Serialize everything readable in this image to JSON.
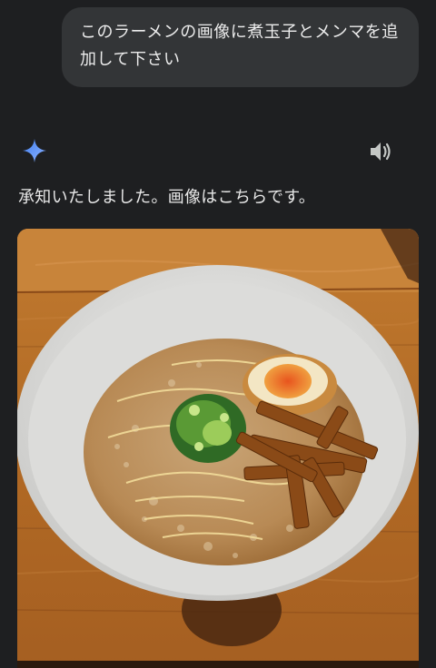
{
  "conversation": {
    "user_message": "このラーメンの画像に煮玉子とメンマを追加して下さい",
    "assistant_reply": "承知いたしました。画像はこちらです。"
  },
  "icons": {
    "assistant": "gemini-sparkle-icon",
    "read_aloud": "speaker-icon"
  },
  "image": {
    "subject": "ramen-bowl-with-egg-and-menma"
  },
  "colors": {
    "background": "#1e1f21",
    "bubble": "#333537",
    "sparkle_start": "#4f8df7",
    "sparkle_end": "#7aa8ff",
    "text": "#e8e8e8"
  }
}
